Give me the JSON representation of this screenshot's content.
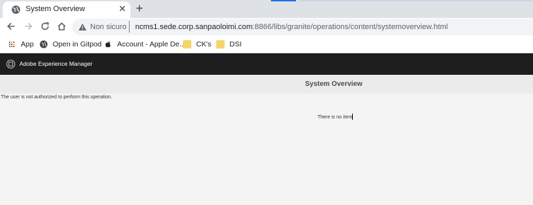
{
  "browser": {
    "tab": {
      "title": "System Overview"
    },
    "address_bar": {
      "security_label": "Non sicuro",
      "url_host": "ncms1.sede.corp.sanpaoloimi.com",
      "url_path": ":8866/libs/granite/operations/content/systemoverview.html"
    },
    "bookmarks": [
      {
        "label": "App",
        "icon": "apps-grid-icon"
      },
      {
        "label": "Open in Gitpod",
        "icon": "gitpod-icon"
      },
      {
        "label": "Account - Apple De...",
        "icon": "apple-icon"
      },
      {
        "label": "CK's",
        "icon": "folder-icon"
      },
      {
        "label": "DSI",
        "icon": "folder-icon"
      }
    ],
    "accent_color": "#1a73e8"
  },
  "app": {
    "product_name": "Adobe Experience Manager",
    "page_title": "System Overview",
    "header_color": "#1e1e1e"
  },
  "content": {
    "error_message": "The user is not authorized to perform this operation.",
    "empty_message": "There is no item"
  }
}
